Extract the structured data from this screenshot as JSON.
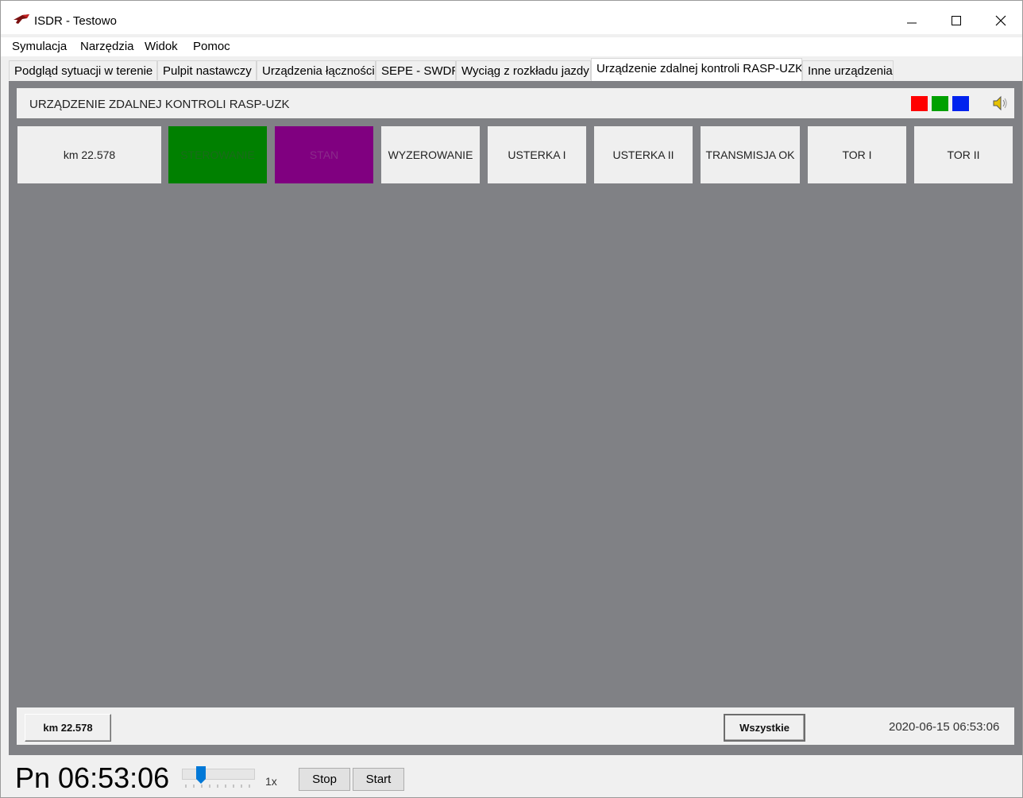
{
  "window": {
    "title": "ISDR - Testowo",
    "min_glyph": "—",
    "max_glyph": "☐",
    "close_glyph": "✕"
  },
  "menu": {
    "items": [
      "Symulacja",
      "Narzędzia",
      "Widok",
      "Pomoc"
    ]
  },
  "tabs": {
    "items": [
      "Podgląd sytuacji w terenie",
      "Pulpit nastawczy",
      "Urządzenia łączności",
      "SEPE - SWDR",
      "Wyciąg z rozkładu jazdy",
      "Urządzenie zdalnej kontroli RASP-UZK",
      "Inne urządzenia"
    ],
    "active_index": 5
  },
  "panel": {
    "title": "URZĄDZENIE ZDALNEJ KONTROLI RASP-UZK",
    "swatches": [
      "#ff0000",
      "#00a000",
      "#0022ee"
    ],
    "speaker_icon": "speaker-muted-icon"
  },
  "control_buttons": [
    {
      "label": "km 22.578",
      "bg": "#efefef",
      "fg": "#222222"
    },
    {
      "label": "STEROWANIE",
      "bg": "#008000",
      "fg": "#1a6b1a"
    },
    {
      "label": "STAN",
      "bg": "#800080",
      "fg": "#8a2a8a"
    },
    {
      "label": "WYZEROWANIE",
      "bg": "#efefef",
      "fg": "#222222"
    },
    {
      "label": "USTERKA I",
      "bg": "#efefef",
      "fg": "#222222"
    },
    {
      "label": "USTERKA II",
      "bg": "#efefef",
      "fg": "#222222"
    },
    {
      "label": "TRANSMISJA OK",
      "bg": "#efefef",
      "fg": "#222222"
    },
    {
      "label": "TOR I",
      "bg": "#efefef",
      "fg": "#222222"
    },
    {
      "label": "TOR II",
      "bg": "#efefef",
      "fg": "#222222"
    }
  ],
  "footer": {
    "km_button": "km 22.578",
    "filter_button": "Wszystkie",
    "datetime": "2020-06-15 06:53:06"
  },
  "status": {
    "clock": "Pn 06:53:06",
    "speed": "1x",
    "stop_label": "Stop",
    "start_label": "Start"
  },
  "colors": {
    "workspace": "#808185",
    "accent": "#0078d7"
  }
}
